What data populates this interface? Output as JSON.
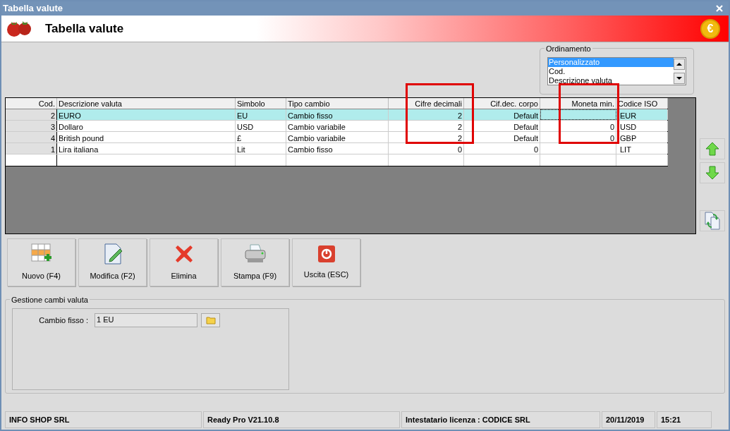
{
  "window": {
    "title": "Tabella valute"
  },
  "header": {
    "title": "Tabella valute",
    "coin_symbol": "€"
  },
  "ordering": {
    "label": "Ordinamento",
    "items": [
      {
        "label": "Personalizzato",
        "selected": true
      },
      {
        "label": "Cod.",
        "selected": false
      },
      {
        "label": "Descrizione valuta",
        "selected": false
      }
    ]
  },
  "table": {
    "columns": [
      {
        "label": "Cod.",
        "highlighted": false
      },
      {
        "label": "Descrizione valuta",
        "highlighted": false
      },
      {
        "label": "Simbolo",
        "highlighted": false
      },
      {
        "label": "Tipo cambio",
        "highlighted": false
      },
      {
        "label": "Cifre decimali",
        "highlighted": true
      },
      {
        "label": "Cif.dec. corpo",
        "highlighted": false
      },
      {
        "label": "Moneta min.",
        "highlighted": true
      },
      {
        "label": "Codice ISO",
        "highlighted": false
      }
    ],
    "rows": [
      {
        "selected": true,
        "cells": [
          "2",
          "EURO",
          "EU",
          "Cambio fisso",
          "2",
          "Default",
          null,
          "EUR"
        ]
      },
      {
        "selected": false,
        "cells": [
          "3",
          "Dollaro",
          "USD",
          "Cambio variabile",
          "2",
          "Default",
          "0",
          "USD"
        ]
      },
      {
        "selected": false,
        "cells": [
          "4",
          "British pound",
          "£",
          "Cambio variabile",
          "2",
          "Default",
          "0",
          "GBP"
        ]
      },
      {
        "selected": false,
        "cells": [
          "1",
          "Lira italiana",
          "Lit",
          "Cambio fisso",
          "0",
          "0",
          null,
          "LIT"
        ]
      }
    ]
  },
  "side_buttons": [
    {
      "kind": "up"
    },
    {
      "kind": "down"
    },
    {
      "kind": "refresh"
    }
  ],
  "buttons": [
    {
      "kind": "new",
      "label": "Nuovo (F4)"
    },
    {
      "kind": "edit",
      "label": "Modifica (F2)"
    },
    {
      "kind": "delete",
      "label": "Elimina"
    },
    {
      "kind": "print",
      "label": "Stampa (F9)"
    },
    {
      "kind": "exit",
      "label": "Uscita (ESC)"
    }
  ],
  "exchange": {
    "title": "Gestione cambi valuta",
    "field_label": "Cambio fisso :",
    "field_value": "1 EU"
  },
  "status_bar": [
    "INFO SHOP SRL",
    "Ready Pro V21.10.8",
    "Intestatario licenza : CODICE SRL",
    "20/11/2019",
    "15:21"
  ]
}
